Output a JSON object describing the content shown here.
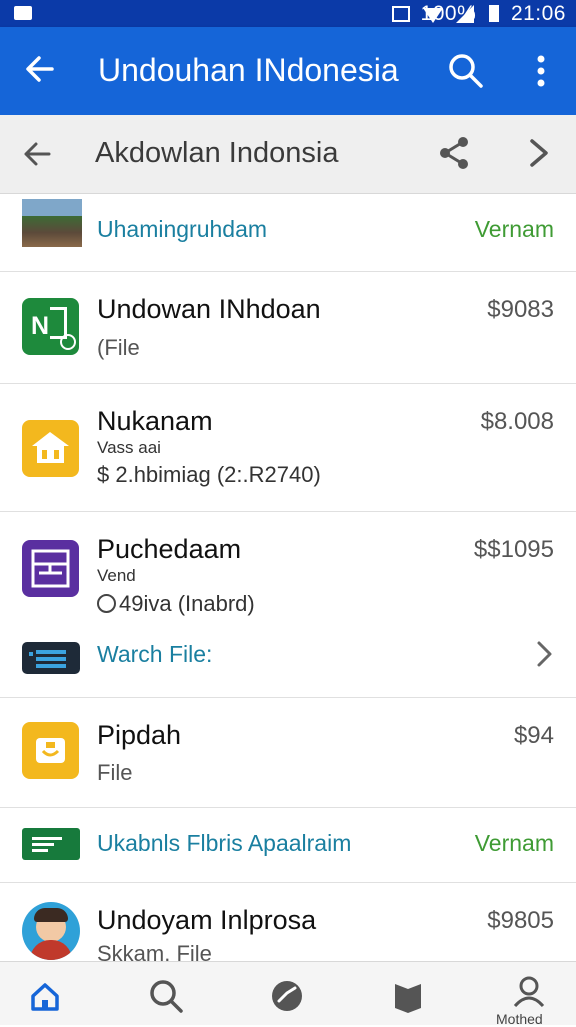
{
  "status": {
    "battery": "100%",
    "time": "21:06"
  },
  "appbar": {
    "title": "Undouhan INdonesia"
  },
  "subbar": {
    "title": "Akdowlan Indonsia"
  },
  "rows": [
    {
      "name": "Uhamingruhdam",
      "tag": "Vernam"
    },
    {
      "name": "Undowan INhdoan",
      "sub": "(File",
      "price": "$9083"
    },
    {
      "name": "Nukanam",
      "small": "Vass aai",
      "sub": "$ 2.hbimiag (2:.R2740)",
      "price": "$8.008"
    },
    {
      "name": "Puchedaam",
      "small": "Vend",
      "sub": "49iva (Inabrd)",
      "price": "$$1095"
    },
    {
      "link": "Warch File:"
    },
    {
      "name": "Pipdah",
      "sub": "File",
      "price": "$94"
    },
    {
      "link": "Ukabnls Flbris Apaalraim",
      "tag": "Vernam"
    },
    {
      "name": "Undoyam Inlprosa",
      "sub": "Skkam. File",
      "price": "$9805"
    }
  ],
  "bottomnav": {
    "profile_label": "Mothed"
  },
  "colors": {
    "appbar": "#1565d8",
    "statusbar": "#0b3aa8",
    "link": "#1a7fa0",
    "tag": "#3f9b34"
  }
}
